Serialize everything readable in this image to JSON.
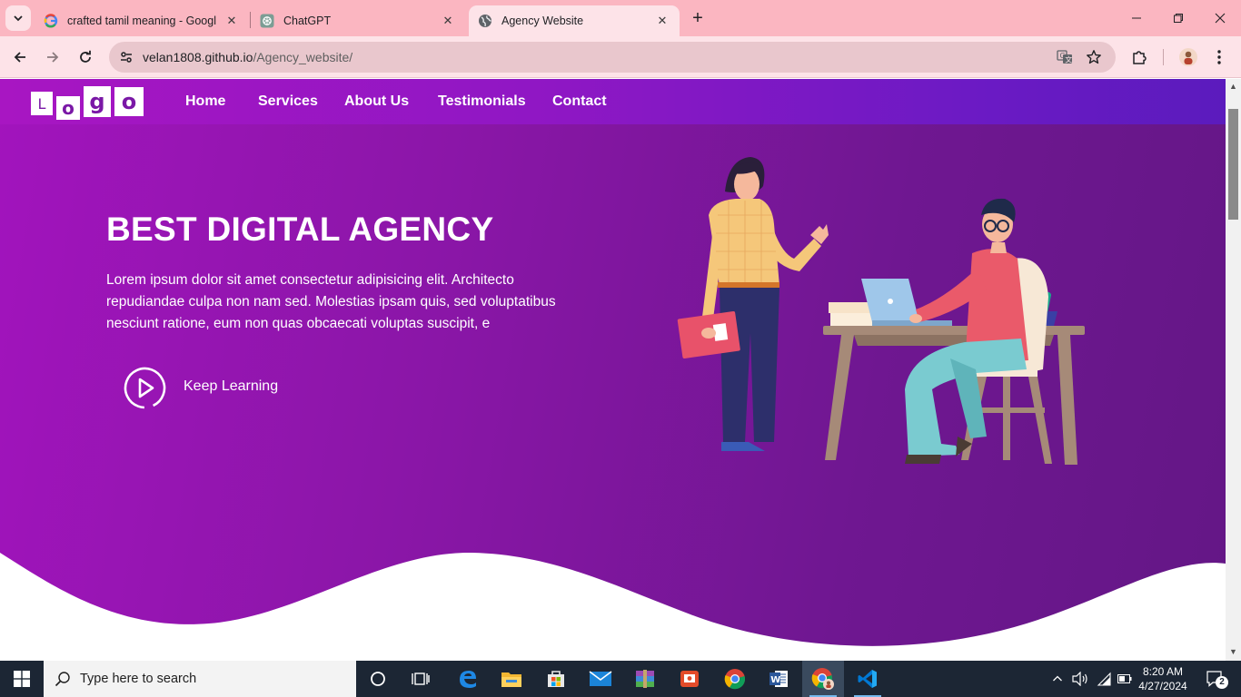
{
  "browser": {
    "tabs": [
      {
        "title": "crafted tamil meaning - Googl",
        "favicon": "google-icon"
      },
      {
        "title": "ChatGPT",
        "favicon": "chatgpt-icon"
      },
      {
        "title": "Agency Website",
        "favicon": "globe-icon",
        "active": true
      }
    ],
    "url_host": "velan1808.github.io",
    "url_path": "/Agency_website/"
  },
  "site": {
    "logo_letters": [
      "L",
      "o",
      "g",
      "o"
    ],
    "nav": [
      "Home",
      "Services",
      "About Us",
      "Testimonials",
      "Contact"
    ],
    "hero_title": "BEST DIGITAL AGENCY",
    "hero_text": "Lorem ipsum dolor sit amet consectetur adipisicing elit. Architecto repudiandae culpa non nam sed. Molestias ipsam quis, sed voluptatibus nesciunt ratione, eum non quas obcaecati voluptas suscipit, e",
    "cta_label": "Keep Learning",
    "colors": {
      "primary": "#8b16a8",
      "accent": "#a214bd"
    }
  },
  "taskbar": {
    "search_placeholder": "Type here to search",
    "time": "8:20 AM",
    "date": "4/27/2024",
    "notification_count": "2"
  }
}
